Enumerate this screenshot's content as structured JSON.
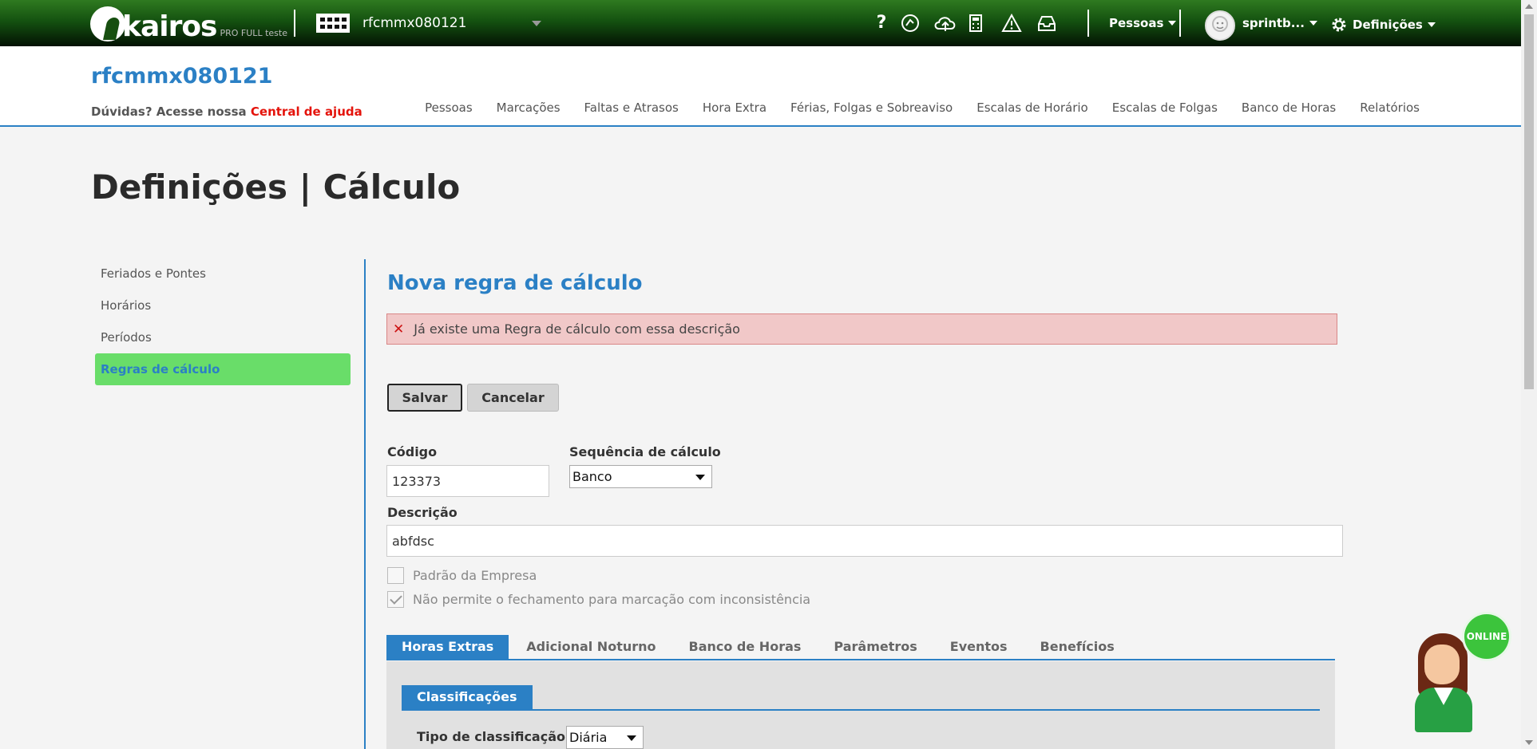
{
  "topbar": {
    "logo_text": "kairos",
    "logo_sub": "PRO FULL teste",
    "company": "rfcmmx080121",
    "icons": [
      "help-icon",
      "feedback-icon",
      "cloud-upload-icon",
      "calculator-icon",
      "warning-icon",
      "inbox-icon"
    ],
    "pessoas_label": "Pessoas",
    "user_label": "sprintb...",
    "settings_label": "Definições"
  },
  "header": {
    "company_title": "rfcmmx080121",
    "help_prefix": "Dúvidas? Acesse nossa",
    "help_link": "Central de ajuda",
    "nav": [
      "Pessoas",
      "Marcações",
      "Faltas e Atrasos",
      "Hora Extra",
      "Férias, Folgas e Sobreaviso",
      "Escalas de Horário",
      "Escalas de Folgas",
      "Banco de Horas",
      "Relatórios"
    ]
  },
  "page": {
    "title": "Definições | Cálculo"
  },
  "sidebar": {
    "items": [
      {
        "label": "Feriados e Pontes"
      },
      {
        "label": "Horários"
      },
      {
        "label": "Períodos"
      },
      {
        "label": "Regras de cálculo"
      }
    ],
    "active_index": 3
  },
  "form": {
    "section_title": "Nova regra de cálculo",
    "error_message": "Já existe uma Regra de cálculo com essa descrição",
    "save_label": "Salvar",
    "cancel_label": "Cancelar",
    "codigo_label": "Código",
    "codigo_value": "123373",
    "sequencia_label": "Sequência de cálculo",
    "sequencia_value": "Banco",
    "descricao_label": "Descrição",
    "descricao_value": "abfdsc",
    "padrao_label": "Padrão da Empresa",
    "padrao_checked": false,
    "fechamento_label": "Não permite o fechamento para marcação com inconsistência",
    "fechamento_checked": true
  },
  "tabs": {
    "items": [
      "Horas Extras",
      "Adicional Noturno",
      "Banco de Horas",
      "Parâmetros",
      "Eventos",
      "Benefícios"
    ],
    "active_index": 0
  },
  "panel": {
    "subtab": "Classificações",
    "tipo_label": "Tipo de classificação:",
    "tipo_value": "Diária"
  },
  "chat": {
    "status": "ONLINE"
  },
  "colors": {
    "accent_blue": "#2b80c5",
    "active_green": "#69dd69",
    "error_bg": "#f1c8c8",
    "error_red": "#e4130b",
    "topbar_green": "#145210"
  }
}
